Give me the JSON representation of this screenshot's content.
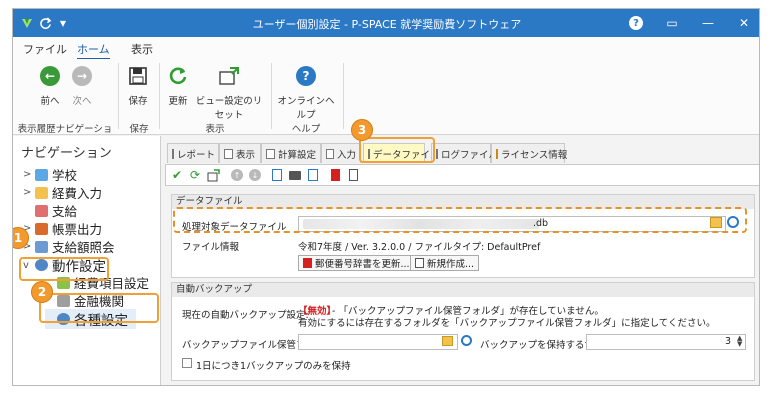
{
  "window": {
    "title": "ユーザー個別設定 - P-SPACE 就学奨励費ソフトウェア",
    "help_symbol": "?",
    "maximize_symbol": "▭",
    "minimize_symbol": "—",
    "close_symbol": "✕"
  },
  "ribbon_tabs": [
    "ファイル",
    "ホーム",
    "表示"
  ],
  "ribbon": {
    "back": "前へ",
    "next": "次へ",
    "save": "保存",
    "refresh": "更新",
    "reset_view": "ビュー設定のリセット",
    "online_help": "オンラインヘルプ",
    "groups": {
      "history": "表示履歴ナビゲーション",
      "save": "保存",
      "view": "表示",
      "help": "ヘルプ"
    }
  },
  "navigation": {
    "title": "ナビゲーション",
    "items": [
      {
        "label": "学校",
        "expand": ">"
      },
      {
        "label": "経費入力",
        "expand": ">"
      },
      {
        "label": "支給",
        "expand": ""
      },
      {
        "label": "帳票出力",
        "expand": ">"
      },
      {
        "label": "支給額照会",
        "expand": ">"
      },
      {
        "label": "動作設定",
        "expand": "v"
      },
      {
        "label": "経費項目設定",
        "expand": ""
      },
      {
        "label": "金融機関",
        "expand": ""
      },
      {
        "label": "各種設定",
        "expand": ""
      }
    ]
  },
  "doc_tabs": [
    "レポート",
    "表示",
    "計算設定",
    "入力",
    "データファイル",
    "ログファイル",
    "ライセンス情報"
  ],
  "data_file": {
    "section": "データファイル",
    "path_label": "処理対象データファイル",
    "path_value": ".db",
    "info_label": "ファイル情報",
    "info_value": "令和7年度 / Ver. 3.2.0.0 / ファイルタイプ: DefaultPref",
    "postal_button": "郵便番号辞書を更新...",
    "new_button": "新規作成..."
  },
  "backup": {
    "section": "自動バックアップ",
    "current_label": "現在の自動バックアップ設定:",
    "status": "【無効】",
    "message1": "- 「バックアップファイル保管フォルダ」が存在していません。",
    "message2": "有効にするには存在するフォルダを「バックアップファイル保管フォルダ」に指定してください。",
    "folder_label": "バックアップファイル保管フォルダ",
    "folder_value": "",
    "generations_label": "バックアップを保持する世代数",
    "generations_value": "3",
    "daily_label": "1日につき1バックアップのみを保持"
  },
  "callouts": [
    "1",
    "2",
    "3"
  ],
  "colors": {
    "titlebar": "#2b78c5",
    "accent": "#1f5fa8",
    "callout": "#f0a034",
    "warning": "#d62020"
  }
}
